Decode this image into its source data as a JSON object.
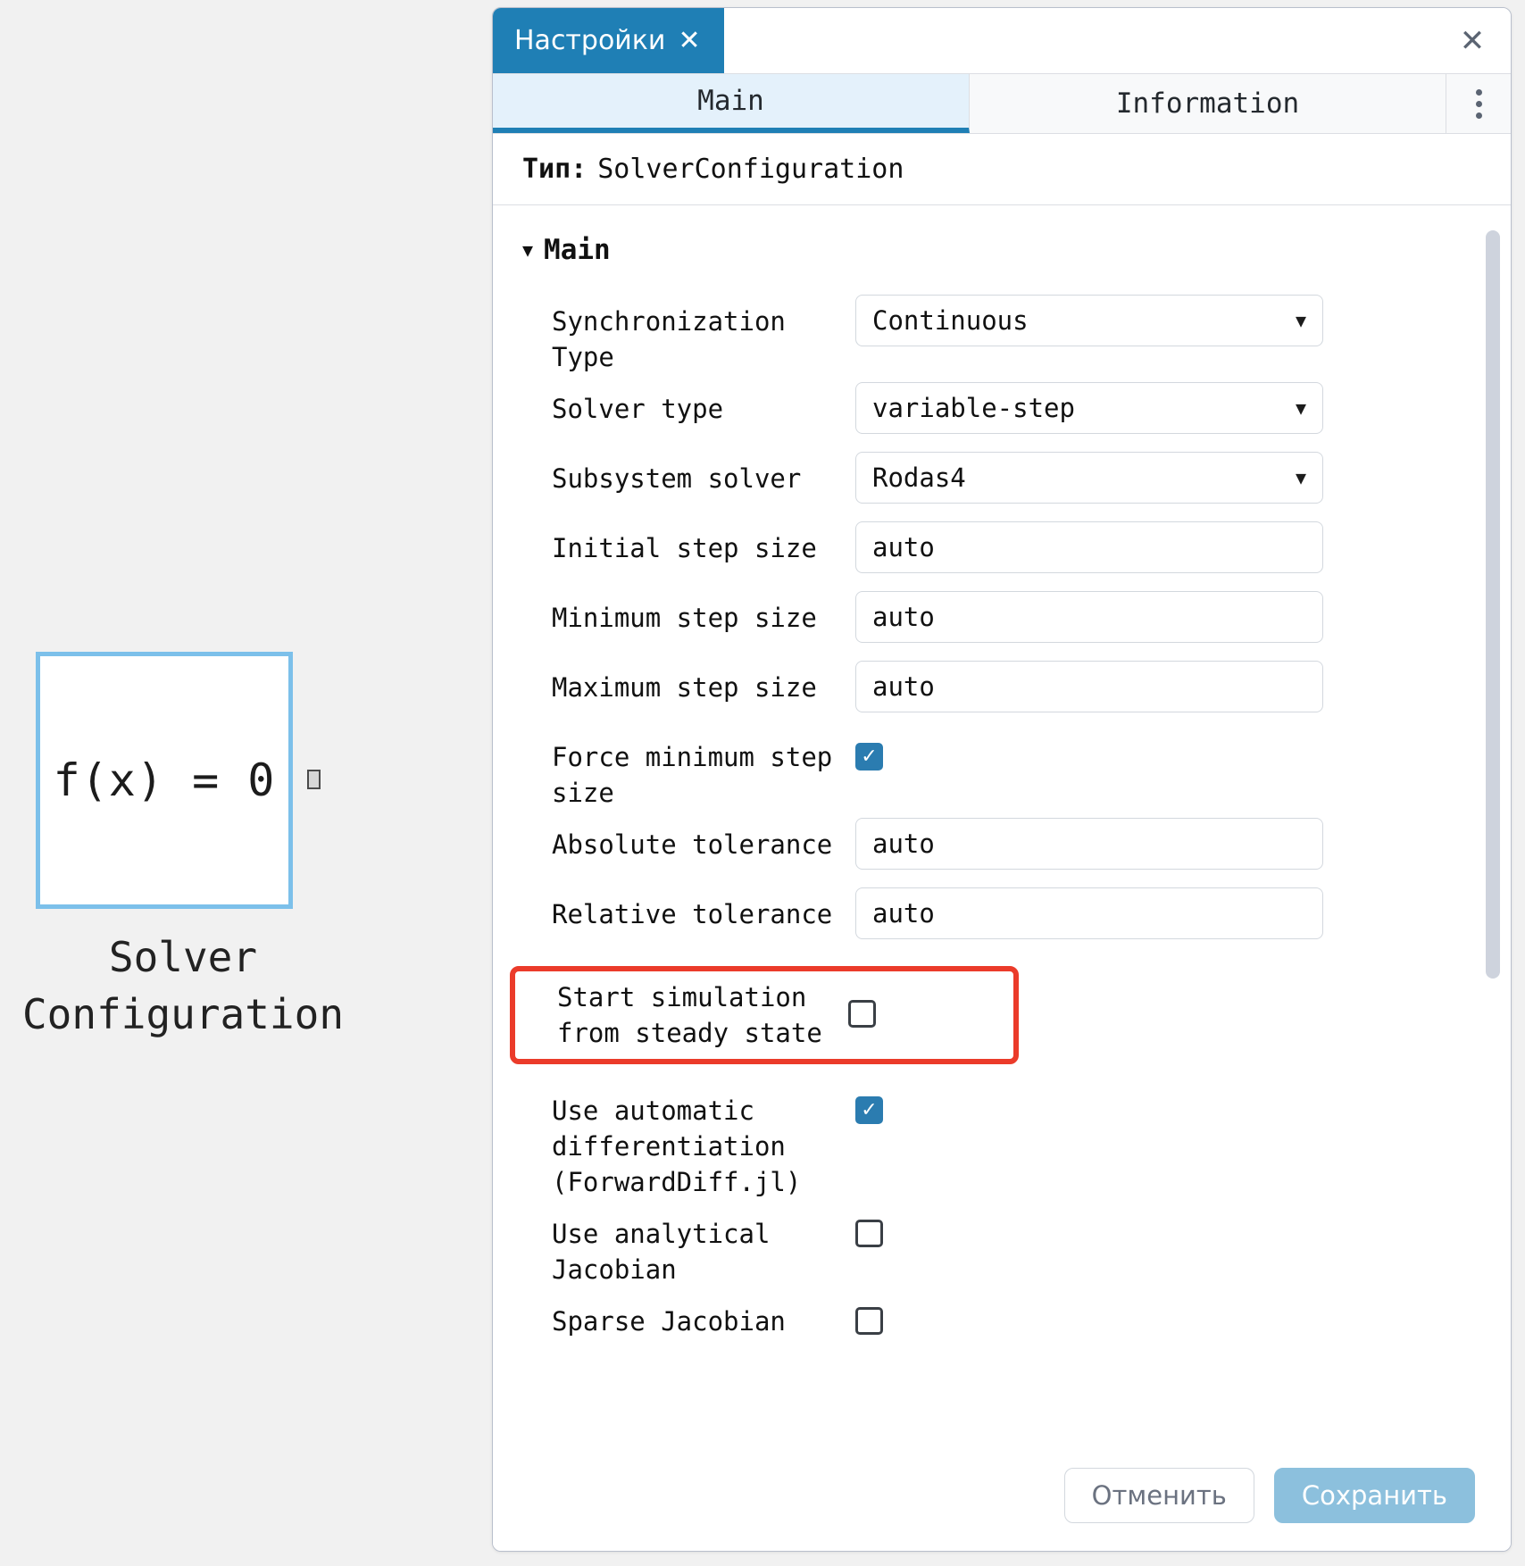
{
  "canvas": {
    "block": {
      "equation": "f(x) = 0",
      "label_line1": "Solver",
      "label_line2": "Configuration",
      "border_color": "#7cc0ea",
      "port_name": "output-port"
    }
  },
  "panel": {
    "window_tab": {
      "title": "Настройки",
      "close_glyph": "✕",
      "background": "#1f7fb5"
    },
    "window_close_glyph": "✕",
    "tabs": [
      {
        "label": "Main",
        "active": true
      },
      {
        "label": "Information",
        "active": false
      }
    ],
    "overflow_menu": "kebab-menu",
    "type_row": {
      "key": "Тип:",
      "value": "SolverConfiguration"
    },
    "group": {
      "caret": "▼",
      "title": "Main"
    },
    "fields": [
      {
        "label": "Synchronization Type",
        "kind": "select",
        "value": "Continuous",
        "caret": "▼",
        "name": "synchronization-type"
      },
      {
        "label": "Solver type",
        "kind": "select",
        "value": "variable-step",
        "caret": "▼",
        "name": "solver-type"
      },
      {
        "label": "Subsystem solver",
        "kind": "select",
        "value": "Rodas4",
        "caret": "▼",
        "name": "subsystem-solver"
      },
      {
        "label": "Initial step size",
        "kind": "text",
        "value": "auto",
        "name": "initial-step-size"
      },
      {
        "label": "Minimum step size",
        "kind": "text",
        "value": "auto",
        "name": "minimum-step-size"
      },
      {
        "label": "Maximum step size",
        "kind": "text",
        "value": "auto",
        "name": "maximum-step-size"
      },
      {
        "label": "Force minimum step size",
        "kind": "checkbox",
        "checked": true,
        "name": "force-minimum-step-size"
      },
      {
        "label": "Absolute tolerance",
        "kind": "text",
        "value": "auto",
        "name": "absolute-tolerance"
      },
      {
        "label": "Relative tolerance",
        "kind": "text",
        "value": "auto",
        "name": "relative-tolerance"
      },
      {
        "label": "Start simulation from steady state",
        "kind": "checkbox",
        "checked": false,
        "highlighted": true,
        "highlight_color": "#eb3b2a",
        "name": "start-simulation-from-steady-state"
      },
      {
        "label": "Use automatic differentiation (ForwardDiff.jl)",
        "kind": "checkbox",
        "checked": true,
        "name": "use-automatic-differentiation"
      },
      {
        "label": "Use analytical Jacobian",
        "kind": "checkbox",
        "checked": false,
        "name": "use-analytical-jacobian"
      },
      {
        "label": "Sparse Jacobian",
        "kind": "checkbox",
        "checked": false,
        "name": "sparse-jacobian"
      }
    ],
    "footer": {
      "cancel_label": "Отменить",
      "save_label": "Сохранить",
      "save_color": "#8cc0dd"
    }
  }
}
